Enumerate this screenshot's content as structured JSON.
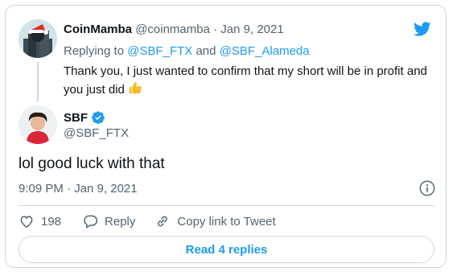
{
  "reply_tweet": {
    "name": "CoinMamba",
    "handle": "@coinmamba",
    "separator": "·",
    "date": "Jan 9, 2021",
    "replying_to_prefix": "Replying to",
    "replying_to_users": [
      "@SBF_FTX",
      "@SBF_Alameda"
    ],
    "replying_to_joiner": "and",
    "text": "Thank you, I just wanted to confirm that my short will be in profit and you just did",
    "emoji": "👍"
  },
  "main_tweet": {
    "name": "SBF",
    "handle": "@SBF_FTX",
    "verified": true,
    "text": "lol good luck with that",
    "time": "9:09 PM",
    "separator": "·",
    "date": "Jan 9, 2021"
  },
  "actions": {
    "like_count": "198",
    "reply_label": "Reply",
    "copy_label": "Copy link to Tweet"
  },
  "read_replies_label": "Read 4 replies",
  "colors": {
    "accent": "#1d9bf0",
    "muted": "#536471",
    "border": "#cfd9de",
    "like_thumb": "#f7b928"
  },
  "icons": [
    "twitter-bird-icon",
    "verified-badge-icon",
    "info-icon",
    "heart-icon",
    "reply-icon",
    "copy-link-icon",
    "thumbs-up-icon"
  ]
}
